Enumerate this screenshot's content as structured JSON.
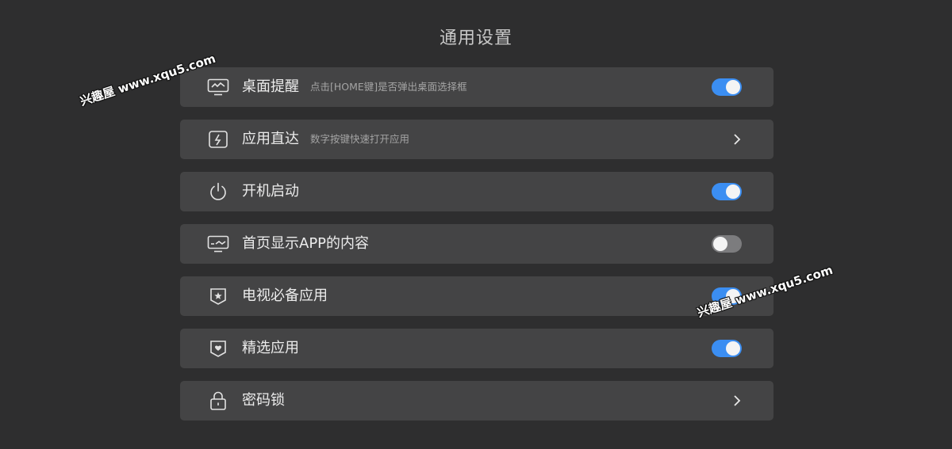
{
  "header": {
    "title": "通用设置"
  },
  "rows": [
    {
      "label": "桌面提醒",
      "description": "点击[HOME键]是否弹出桌面选择框",
      "icon": "monitor-icon",
      "control": "toggle",
      "enabled": true
    },
    {
      "label": "应用直达",
      "description": "数字按键快速打开应用",
      "icon": "lightning-icon",
      "control": "chevron",
      "chevron": "›"
    },
    {
      "label": "开机启动",
      "description": "",
      "icon": "power-icon",
      "control": "toggle",
      "enabled": true
    },
    {
      "label": "首页显示APP的内容",
      "description": "",
      "icon": "tv-icon",
      "control": "toggle",
      "enabled": false
    },
    {
      "label": "电视必备应用",
      "description": "",
      "icon": "star-badge-icon",
      "control": "toggle",
      "enabled": true
    },
    {
      "label": "精选应用",
      "description": "",
      "icon": "heart-badge-icon",
      "control": "toggle",
      "enabled": true
    },
    {
      "label": "密码锁",
      "description": "",
      "icon": "lock-icon",
      "control": "chevron",
      "chevron": "›"
    }
  ],
  "watermarks": [
    "兴趣屋 www.xqu5.com",
    "兴趣屋 www.xqu5.com"
  ],
  "colors": {
    "background": "#2e2e2f",
    "row_background": "#444445",
    "toggle_on": "#3b8ef2",
    "toggle_off": "#7c7c7e",
    "text_primary": "#ececec",
    "text_secondary": "#a4a4a4"
  }
}
